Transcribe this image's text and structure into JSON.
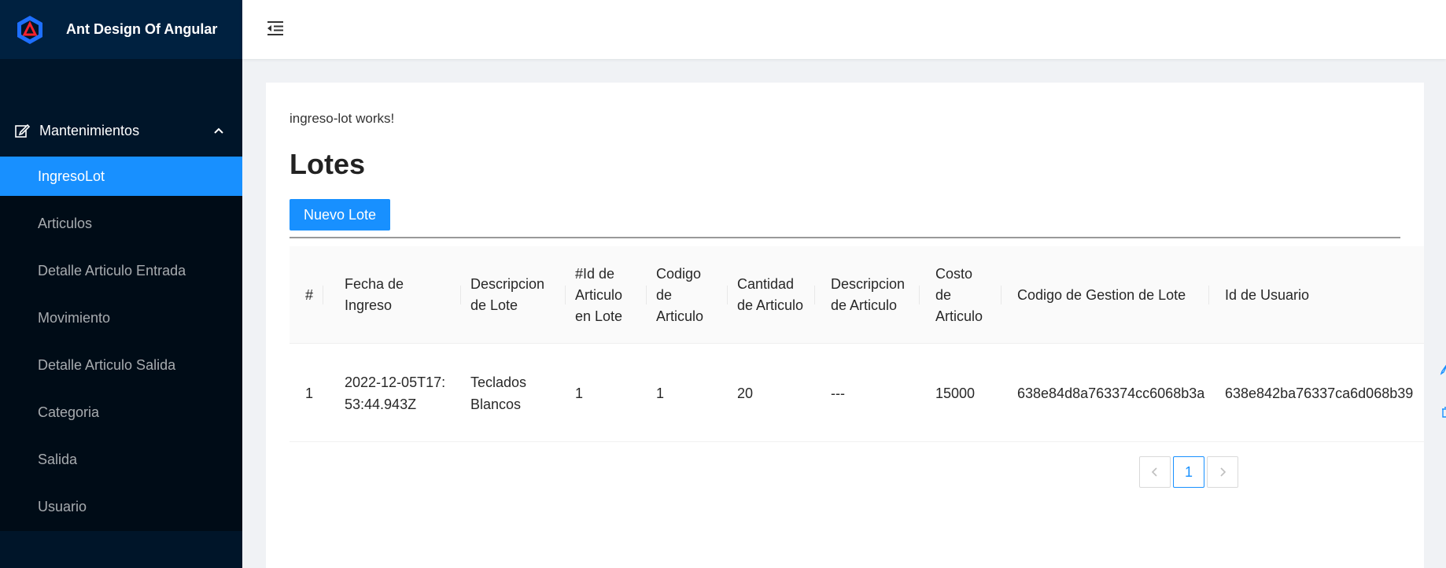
{
  "app": {
    "title": "Ant Design Of Angular"
  },
  "sidebar": {
    "group_label": "Mantenimientos",
    "items": [
      {
        "label": "IngresoLot",
        "active": true
      },
      {
        "label": "Articulos"
      },
      {
        "label": "Detalle Articulo Entrada"
      },
      {
        "label": "Movimiento"
      },
      {
        "label": "Detalle Articulo Salida"
      },
      {
        "label": "Categoria"
      },
      {
        "label": "Salida"
      },
      {
        "label": "Usuario"
      }
    ]
  },
  "main": {
    "works_text": "ingreso-lot works!",
    "title": "Lotes",
    "new_button": "Nuevo Lote"
  },
  "table": {
    "columns": [
      "#",
      "Fecha de Ingreso",
      "Descripcion de Lote",
      "#Id de Articulo en Lote",
      "Codigo de Articulo",
      "Cantidad de Articulo",
      "Descripcion de Articulo",
      "Costo de Articulo",
      "Codigo de Gestion de Lote",
      "Id de Usuario"
    ],
    "rows": [
      [
        "1",
        "2022-12-05T17:53:44.943Z",
        "Teclados Blancos",
        "1",
        "1",
        "20",
        "---",
        "15000",
        "638e84d8a763374cc6068b3a",
        "638e842ba76337ca6d068b39"
      ]
    ]
  },
  "pagination": {
    "prev": "<",
    "current": "1",
    "next": ">"
  },
  "colors": {
    "primary": "#1890ff",
    "sider": "#001529",
    "menu": "#000c17"
  }
}
